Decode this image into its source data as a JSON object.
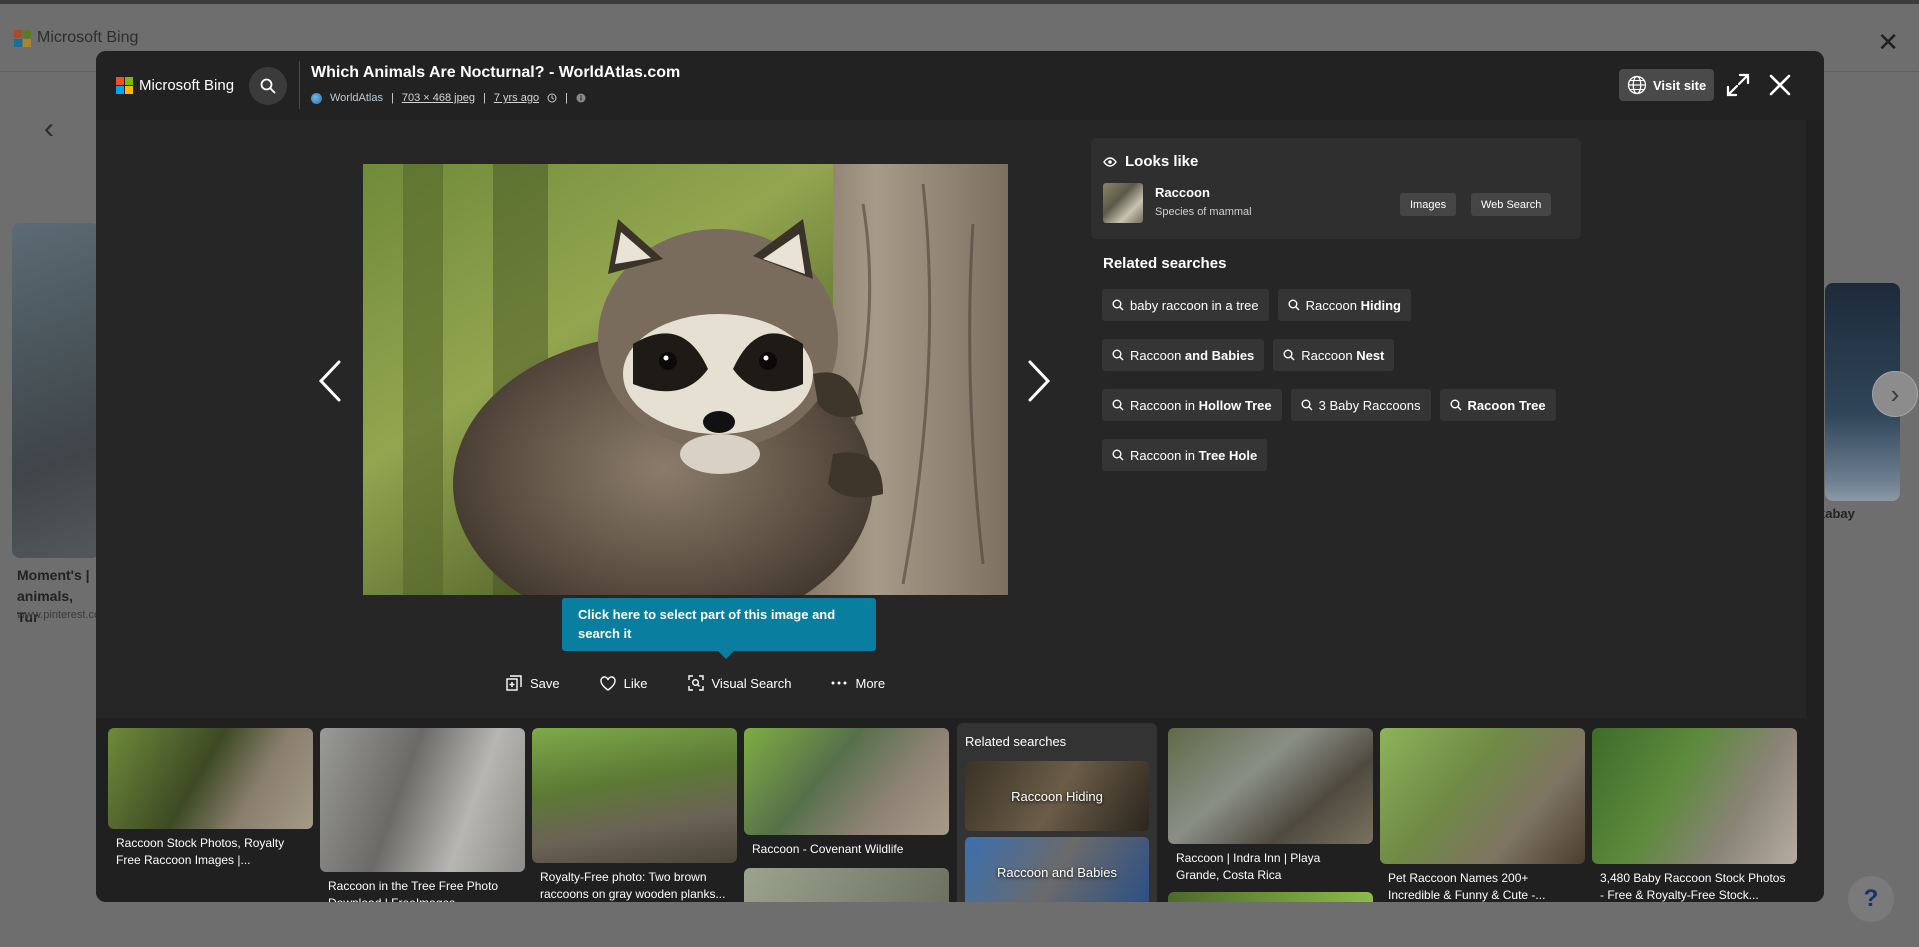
{
  "background": {
    "brand": "Microsoft Bing",
    "left_caption": "Moment's | animals, Tur",
    "left_source": "www.pinterest.co",
    "right_caption": "xabay",
    "help_label": "?"
  },
  "viewer": {
    "brand": "Microsoft Bing",
    "title": "Which Animals Are Nocturnal? - WorldAtlas.com",
    "source": "WorldAtlas",
    "dimensions": "703 × 468 jpeg",
    "age": "7 yrs ago",
    "separator": "|",
    "visit_label": "Visit site",
    "tooltip": "Click here to select part of this image and search it",
    "actions": [
      {
        "label": "Save",
        "icon": "save-icon"
      },
      {
        "label": "Like",
        "icon": "heart-icon"
      },
      {
        "label": "Visual Search",
        "icon": "visual-search-icon"
      },
      {
        "label": "More",
        "icon": "more-icon"
      }
    ]
  },
  "looks_like": {
    "heading": "Looks like",
    "name": "Raccoon",
    "subtitle": "Species of mammal",
    "images_btn": "Images",
    "web_btn": "Web Search"
  },
  "related": {
    "heading": "Related searches",
    "chips": [
      {
        "plain": "baby raccoon in a tree",
        "bold": ""
      },
      {
        "plain": "Raccoon ",
        "bold": "Hiding"
      },
      {
        "plain": "Raccoon ",
        "bold": "and Babies"
      },
      {
        "plain": "Raccoon ",
        "bold": "Nest"
      },
      {
        "plain": "Raccoon in ",
        "bold": "Hollow Tree"
      },
      {
        "plain": "3 Baby Raccoons",
        "bold": ""
      },
      {
        "plain": "",
        "bold": "Racoon Tree"
      },
      {
        "plain": "Raccoon in ",
        "bold": "Tree Hole"
      }
    ]
  },
  "filmstrip": {
    "tiles": [
      {
        "caption": "Raccoon Stock Photos, Royalty Free Raccoon Images |..."
      },
      {
        "caption": "Raccoon in the Tree Free Photo Download | FreeImages"
      },
      {
        "caption": "Royalty-Free photo: Two brown raccoons on gray wooden planks..."
      },
      {
        "caption": "Raccoon - Covenant Wildlife"
      },
      {
        "caption": "Raccoon | Indra Inn | Playa Grande, Costa Rica"
      },
      {
        "caption": "Pet Raccoon Names 200+ Incredible & Funny & Cute -..."
      },
      {
        "caption": "3,480 Baby Raccoon Stock Photos - Free & Royalty-Free Stock..."
      }
    ],
    "related_heading": "Related searches",
    "related_cards": [
      "Raccoon Hiding",
      "Raccoon and Babies"
    ]
  },
  "colors": {
    "modal_bg": "#202020",
    "tooltip_bg": "#0a7e9f",
    "ms_red": "#f25022",
    "ms_green": "#7fba00",
    "ms_blue": "#00a4ef",
    "ms_yellow": "#ffb900"
  }
}
